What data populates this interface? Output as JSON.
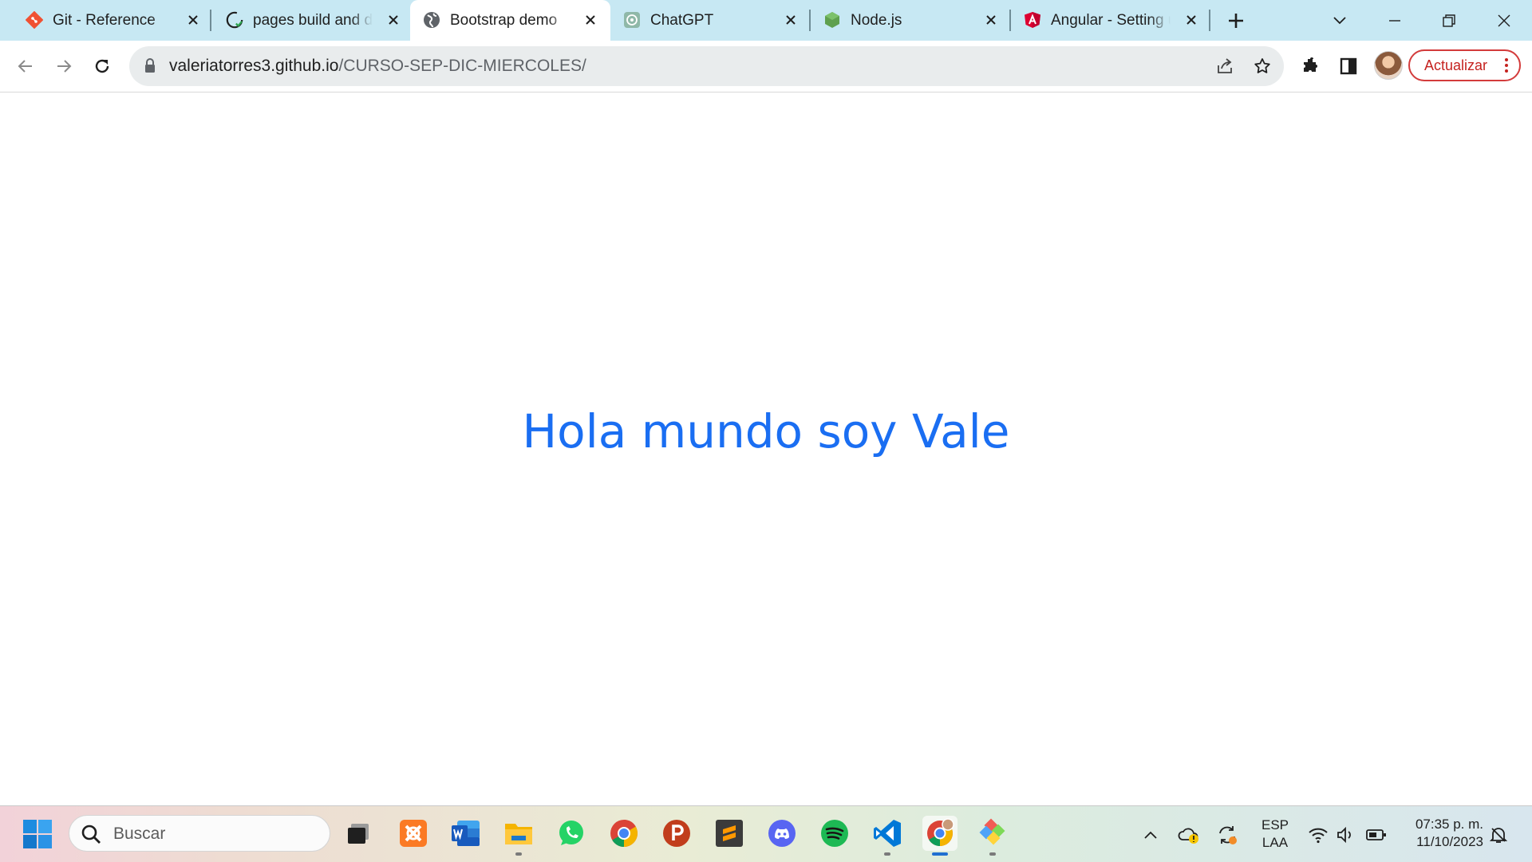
{
  "browser": {
    "tabs": [
      {
        "title": "Git - Reference",
        "icon": "git-icon"
      },
      {
        "title": "pages build and deployment",
        "icon": "github-icon"
      },
      {
        "title": "Bootstrap demo",
        "icon": "globe-icon",
        "active": true
      },
      {
        "title": "ChatGPT",
        "icon": "chatgpt-icon"
      },
      {
        "title": "Node.js",
        "icon": "nodejs-icon"
      },
      {
        "title": "Angular - Setting up the local environment",
        "icon": "angular-icon"
      }
    ],
    "url_host": "valeriatorres3.github.io",
    "url_path": "/CURSO-SEP-DIC-MIERCOLES/",
    "update_label": "Actualizar"
  },
  "page": {
    "heading": "Hola mundo soy Vale",
    "heading_color": "#1a6ef2"
  },
  "taskbar": {
    "search_placeholder": "Buscar",
    "apps": [
      "task-view",
      "xampp",
      "word",
      "file-explorer",
      "whatsapp",
      "chrome",
      "postman",
      "sublime-text",
      "discord",
      "spotify",
      "vscode",
      "chrome-profile",
      "git-kraken"
    ],
    "language_line1": "ESP",
    "language_line2": "LAA",
    "time": "07:35 p. m.",
    "date": "11/10/2023"
  }
}
